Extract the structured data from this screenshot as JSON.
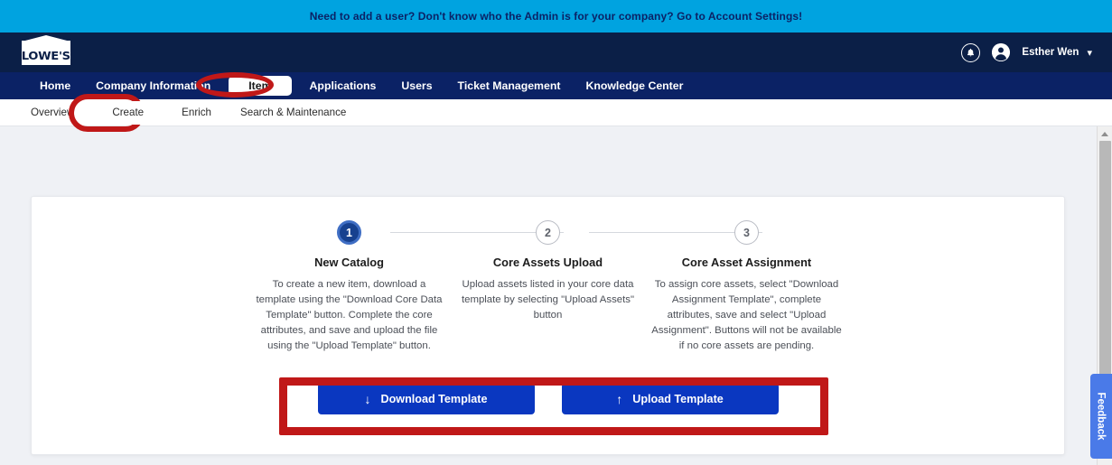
{
  "announcement": {
    "text": "Need to add a user? Don't know who the Admin is for your company? Go to Account Settings!"
  },
  "header": {
    "logo_text": "LOWE'S",
    "user_name": "Esther Wen",
    "bell_icon": "bell-icon",
    "avatar_icon": "user-avatar-icon",
    "chevron_icon": "chevron-down-icon"
  },
  "main_nav": {
    "items": [
      {
        "label": "Home",
        "active": false
      },
      {
        "label": "Company Information",
        "active": false
      },
      {
        "label": "Item",
        "active": true
      },
      {
        "label": "Applications",
        "active": false
      },
      {
        "label": "Users",
        "active": false
      },
      {
        "label": "Ticket Management",
        "active": false
      },
      {
        "label": "Knowledge Center",
        "active": false
      }
    ]
  },
  "sub_nav": {
    "items": [
      {
        "label": "Overview",
        "active": false
      },
      {
        "label": "Create",
        "active": true
      },
      {
        "label": "Enrich",
        "active": false
      },
      {
        "label": "Search & Maintenance",
        "active": false
      }
    ]
  },
  "stepper": {
    "steps": [
      {
        "number": "1",
        "title": "New Catalog",
        "description": "To create a new item, download a template using the \"Download Core Data Template\" button. Complete the core attributes, and save and upload the file using the \"Upload Template\" button.",
        "state": "active"
      },
      {
        "number": "2",
        "title": "Core Assets Upload",
        "description": "Upload assets listed in your core data template by selecting \"Upload Assets\" button",
        "state": "inactive"
      },
      {
        "number": "3",
        "title": "Core Asset Assignment",
        "description": "To assign core assets, select \"Download Assignment Template\", complete attributes, save and select \"Upload Assignment\". Buttons will not be available if no core assets are pending.",
        "state": "inactive"
      }
    ]
  },
  "actions": {
    "download_label": "Download Template",
    "download_icon": "arrow-down-icon",
    "download_arrow": "↓",
    "upload_label": "Upload Template",
    "upload_icon": "arrow-up-icon",
    "upload_arrow": "↑"
  },
  "feedback": {
    "label": "Feedback"
  },
  "colors": {
    "announce_bg": "#00a3e0",
    "header_bg": "#0b1f47",
    "nav_bg": "#0b2265",
    "page_bg": "#eff1f5",
    "button_blue": "#0a37c0",
    "step_active": "#17418f",
    "annotation_red": "#c01818",
    "feedback_blue": "#4a7ae8"
  }
}
